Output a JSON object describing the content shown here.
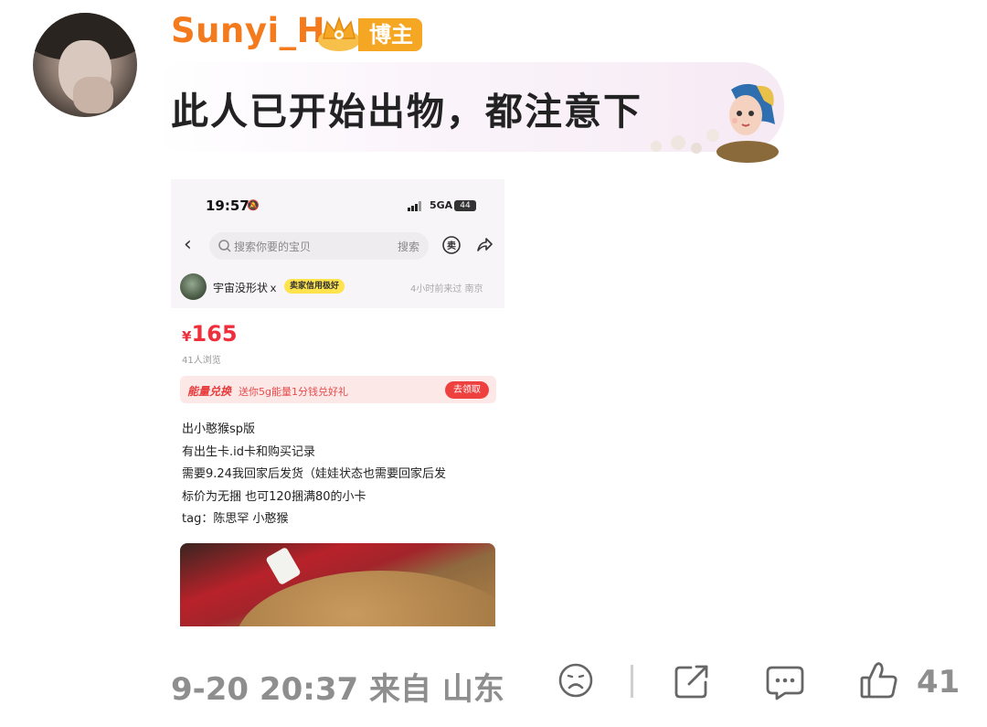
{
  "post": {
    "username": "Sunyi_H",
    "badge_label": "博主",
    "comment_text": "此人已开始出物，都注意下",
    "username_color": "#f37b1d"
  },
  "screenshot": {
    "status_time": "19:57",
    "network": "5GA",
    "battery": "44",
    "search_placeholder": "搜索你要的宝贝",
    "search_button": "搜索",
    "seller_name": "宇宙没形状ｘ",
    "seller_credit": "卖家信用极好",
    "seller_time_location": "4小时前来过  南京",
    "price_symbol": "¥",
    "price": "165",
    "views": "41人浏览",
    "promo_title": "能量兑换",
    "promo_text": "送你5g能量1分钱兑好礼",
    "promo_button": "去领取",
    "description": [
      "出小憨猴sp版",
      "有出生卡.id卡和购买记录",
      "需要9.24我回家后发货（娃娃状态也需要回家后发",
      "标价为无捆 也可120捆满80的小卡",
      "tag：陈思罕 小憨猴"
    ]
  },
  "footer": {
    "timestamp": "9-20 20:37 来自 山东",
    "like_count": "41"
  },
  "icons": [
    "crown-icon",
    "sticker-girl-icon",
    "dislike-icon",
    "share-icon",
    "comment-icon",
    "like-icon",
    "search-icon",
    "back-icon",
    "sell-icon"
  ]
}
